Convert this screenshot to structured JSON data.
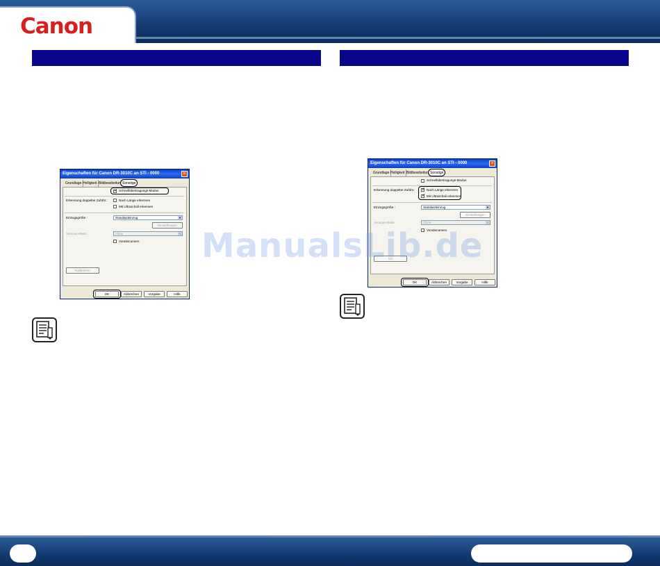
{
  "brand": {
    "logo_text": "Canon",
    "accent_color": "#d81e1e",
    "header_color": "#123a70",
    "section_bar_color": "#08068a"
  },
  "watermark": "ManualsLib.de",
  "dialog_left": {
    "title": "Eigenschaften für Canon DR-3010C an STI - 0000",
    "tabs": [
      "Grundlage",
      "Helligkeit",
      "Bildbearbeitung",
      "Sonstige"
    ],
    "active_tab": "Sonstige",
    "fast_mode": "Schnellübertragungs-Modus",
    "double_feed_label": "Erkennung doppelter Zuführ.:",
    "by_length": "Nach Länge erkennen",
    "by_ultrasonic": "Mit Ultraschall erkennen",
    "paper_size_label": "Einzugsgröße :",
    "paper_size_value": "Standardeinzug",
    "settings_button": "Einstellungen",
    "prescan_label": "Vorscan-Mode :",
    "prescan_value": "Ohne",
    "preview": "Vorabscannen",
    "calibrate_button": "Kalibrieren",
    "ok_button": "OK",
    "cancel_button": "Abbrechen",
    "default_button": "Vorgabe",
    "help_button": "Hilfe"
  },
  "dialog_right": {
    "title": "Eigenschaften für Canon DR-3010C an STI - 0000",
    "tabs": [
      "Grundlage",
      "Helligkeit",
      "Bildbearbeitung",
      "Sonstige"
    ],
    "active_tab": "Sonstige",
    "fast_mode": "Schnellübertragungs-Modus",
    "double_feed_label": "Erkennung doppelter Zuführ.:",
    "by_length": "Nach Länge erkennen",
    "by_ultrasonic": "Mit Ultraschall erkennen",
    "paper_size_label": "Einzugsgröße :",
    "paper_size_value": "Standardeinzug",
    "settings_button": "Einstellungen",
    "prescan_label": "Vorscan-Mode :",
    "prescan_value": "Ohne",
    "preview": "Vorabscannen",
    "calibrate_button": "Ka",
    "ok_button": "OK",
    "cancel_button": "Abbrechen",
    "default_button": "Vorgabe",
    "help_button": "Hilfe"
  }
}
